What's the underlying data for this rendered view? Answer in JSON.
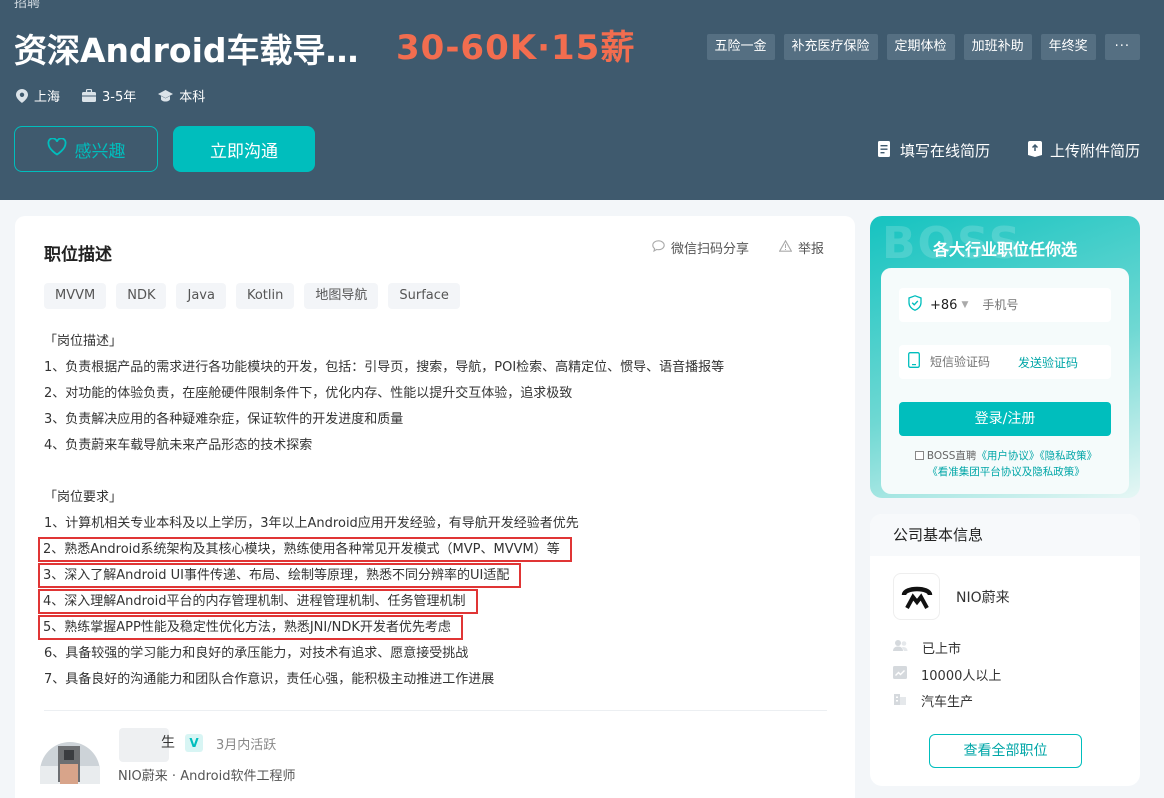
{
  "header": {
    "crumb_cut": "招聘",
    "title": "资深Android车载导…",
    "salary": "30-60K·15薪",
    "welfare": [
      "五险一金",
      "补充医疗保险",
      "定期体检",
      "加班补助",
      "年终奖"
    ],
    "welfare_more": "···",
    "location": "上海",
    "experience": "3-5年",
    "degree": "本科",
    "interest_label": "感兴趣",
    "chat_label": "立即沟通",
    "online_resume": "填写在线简历",
    "upload_resume": "上传附件简历"
  },
  "main": {
    "section_title": "职位描述",
    "share_label": "微信扫码分享",
    "report_label": "举报",
    "skills": [
      "MVVM",
      "NDK",
      "Java",
      "Kotlin",
      "地图导航",
      "Surface"
    ],
    "lines": [
      "「岗位描述」",
      "1、负责根据产品的需求进行各功能模块的开发，包括：引导页，搜索，导航，POI检索、高精定位、惯导、语音播报等",
      "2、对功能的体验负责，在座舱硬件限制条件下，优化内存、性能以提升交互体验，追求极致",
      "3、负责解决应用的各种疑难杂症，保证软件的开发进度和质量",
      "4、负责蔚来车载导航未来产品形态的技术探索",
      "「岗位要求」",
      "1、计算机相关专业本科及以上学历，3年以上Android应用开发经验，有导航开发经验者优先",
      "2、熟悉Android系统架构及其核心模块，熟练使用各种常见开发模式（MVP、MVVM）等",
      "3、深入了解Android UI事件传递、布局、绘制等原理，熟悉不同分辨率的UI适配",
      "4、深入理解Android平台的内存管理机制、进程管理机制、任务管理机制",
      "5、熟练掌握APP性能及稳定性优化方法，熟悉JNI/NDK开发者优先考虑",
      "6、具备较强的学习能力和良好的承压能力，对技术有追求、愿意接受挑战",
      "7、具备良好的沟通能力和团队合作意识，责任心强，能积极主动推进工作进展"
    ],
    "hr": {
      "name_tail": "生",
      "badge": "V",
      "active": "3月内活跃",
      "company_role": "NIO蔚来 · Android软件工程师"
    }
  },
  "login": {
    "title": "各大行业职位任你选",
    "bg_text": "BOSS",
    "country_code": "+86",
    "phone_placeholder": "手机号",
    "code_placeholder": "短信验证码",
    "send_code": "发送验证码",
    "submit": "登录/注册",
    "agree_prefix": "BOSS直聘",
    "user_agreement": "《用户协议》",
    "privacy_policy": "《隐私政策》",
    "group_policy": "《看准集团平台协议及隐私政策》"
  },
  "company": {
    "section_title": "公司基本信息",
    "name": "NIO蔚来",
    "stage": "已上市",
    "size": "10000人以上",
    "industry": "汽车生产",
    "view_all": "查看全部职位"
  },
  "colors": {
    "header_bg": "#3f5a6e",
    "accent": "#00bebd",
    "salary": "#f26d4f",
    "highlight_box": "#e03535"
  }
}
